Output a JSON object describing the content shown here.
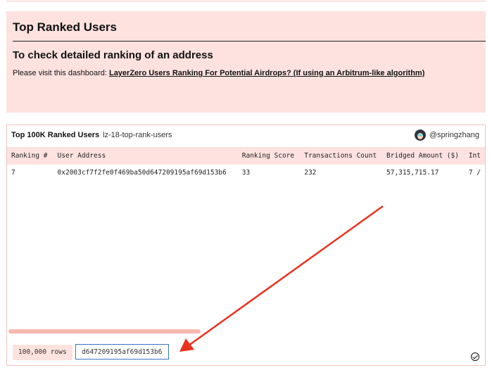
{
  "intro": {
    "title": "Top Ranked Users",
    "subtitle": "To check detailed ranking of an address",
    "text_prefix": "Please visit this dashboard: ",
    "link_text": "LayerZero Users Ranking For Potential Airdrops? (If using an Arbitrum-like algorithm)",
    "text_suffix": ")"
  },
  "card": {
    "title": "Top 100K Ranked Users",
    "slug": "lz-18-top-rank-users",
    "author": "@springzhang"
  },
  "table": {
    "columns": [
      "Ranking #",
      "User Address",
      "Ranking Score",
      "Transactions Count",
      "Bridged Amount ($)",
      "Int"
    ],
    "rows": [
      [
        "7",
        "0x2003cf7f2fe0f469ba50d647209195af69d153b6",
        "33",
        "232",
        "57,315,715.17",
        "7 /"
      ]
    ]
  },
  "footer": {
    "row_count": "100,000 rows",
    "search_value": "d647209195af69d153b6"
  },
  "colors": {
    "accent_bg": "#fde2df",
    "arrow": "#e8331f",
    "search_border": "#3a73c7"
  }
}
